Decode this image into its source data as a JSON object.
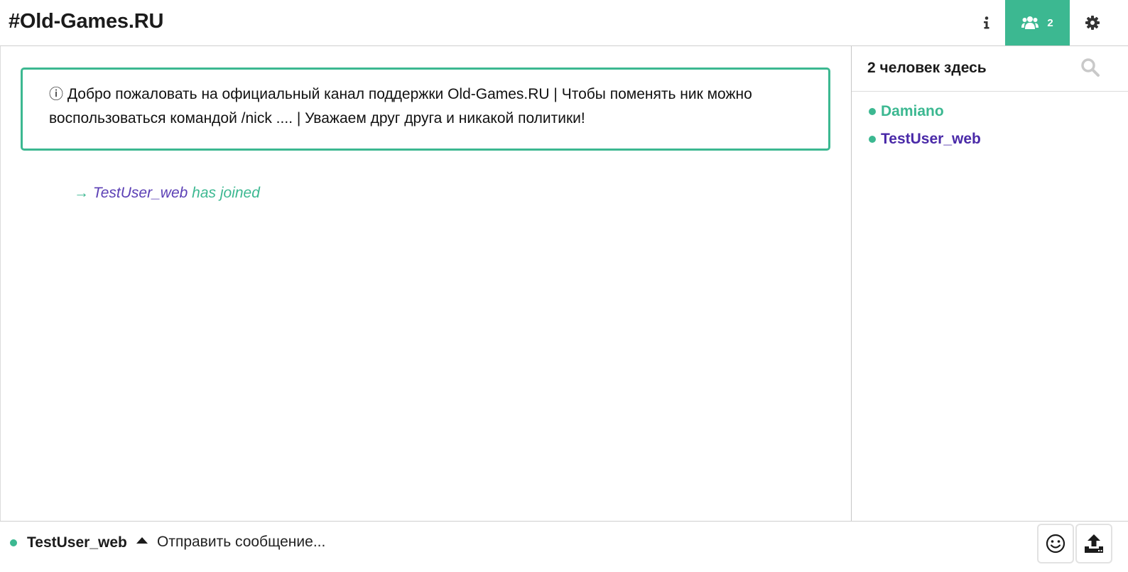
{
  "header": {
    "channel_title": "#Old-Games.RU",
    "member_count": "2",
    "icons": {
      "info": "info-icon",
      "members": "users-icon",
      "settings": "gear-icon"
    },
    "accent_color": "#3cb891"
  },
  "main": {
    "topic": "Добро пожаловать на официальный канал поддержки Old-Games.RU | Чтобы поменять ник можно воспользоваться командой /nick .... | Уважаем друг друга и никакой политики!",
    "topic_icon": "ⓘ",
    "events": [
      {
        "arrow": "→",
        "nick": "TestUser_web",
        "text": "has joined"
      }
    ]
  },
  "sidebar": {
    "title": "2 человек здесь",
    "search_icon": "search-icon",
    "members": [
      {
        "nick": "Damiano",
        "color": "#3cb891"
      },
      {
        "nick": "TestUser_web",
        "color": "#4a2aa8"
      }
    ]
  },
  "footer": {
    "nick": "TestUser_web",
    "input_value": "",
    "input_placeholder": "Отправить сообщение...",
    "icons": {
      "emoji": "smiley-icon",
      "upload": "upload-icon"
    }
  }
}
